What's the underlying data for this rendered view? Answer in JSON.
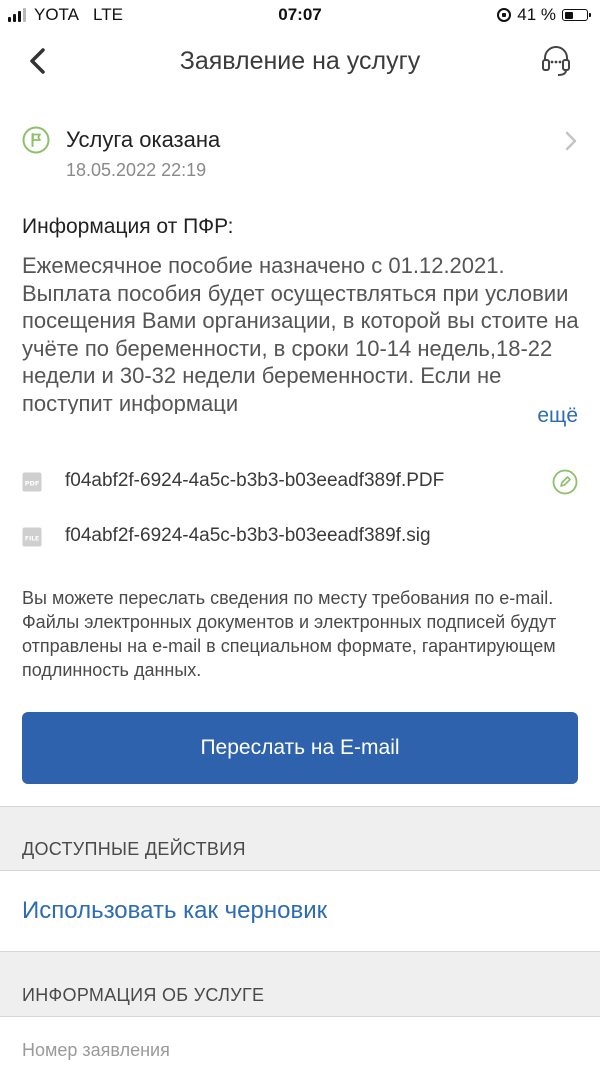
{
  "status_bar": {
    "carrier": "YOTA",
    "network": "LTE",
    "time": "07:07",
    "battery": "41 %",
    "battery_level": 0.41
  },
  "nav": {
    "title": "Заявление на услугу",
    "back_icon": "chevron-left-icon",
    "support_icon": "headset-icon"
  },
  "service_status": {
    "title": "Услуга оказана",
    "date": "18.05.2022 22:19",
    "accent_color": "#8dc06a"
  },
  "info": {
    "heading": "Информация от ПФР:",
    "text": "Ежемесячное пособие назначено с 01.12.2021. Выплата пособия будет осуществляться при условии посещения Вами организации, в которой вы стоите на учёте по беременности, в сроки 10-14 недель,18-22 недели и 30-32 недели беременности. Если не поступит информаци",
    "more_label": "ещё"
  },
  "files": [
    {
      "type": "PDF",
      "name": "f04abf2f-6924-4a5c-b3b3-b03eeadf389f.PDF"
    },
    {
      "type": "FILE",
      "name": "f04abf2f-6924-4a5c-b3b3-b03eeadf389f.sig"
    }
  ],
  "note": "Вы можете переслать сведения по месту требования по e-mail. Файлы электронных документов и электронных подписей будут отправлены на e-mail в специальном формате, гарантирующем  подлинность данных.",
  "send_button": {
    "label": "Переслать на E-mail",
    "color": "#2f62ad"
  },
  "sections": {
    "actions_header": "ДОСТУПНЫЕ ДЕЙСТВИЯ",
    "draft_link": "Использовать как черновик",
    "info_header": "ИНФОРМАЦИЯ ОБ УСЛУГЕ",
    "app_number_label": "Номер заявления"
  },
  "colors": {
    "link": "#2d6cb3"
  }
}
